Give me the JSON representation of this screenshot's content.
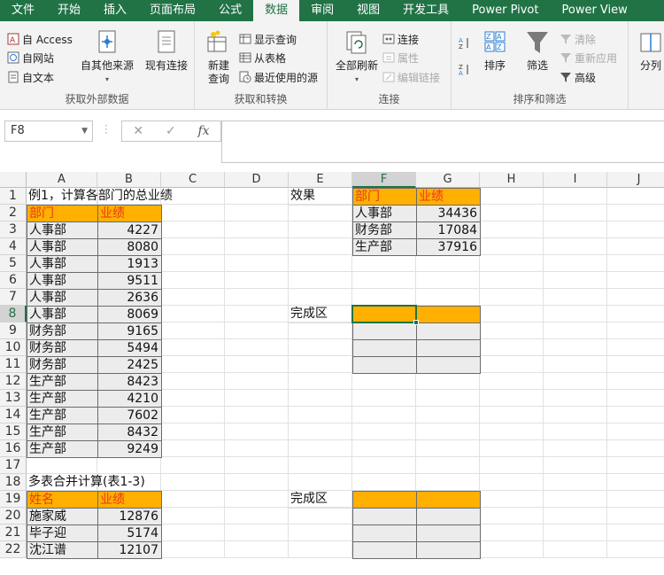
{
  "tabs": [
    "文件",
    "开始",
    "插入",
    "页面布局",
    "公式",
    "数据",
    "审阅",
    "视图",
    "开发工具",
    "Power Pivot",
    "Power View"
  ],
  "active_tab_index": 5,
  "ribbon": {
    "get_external": {
      "access": "自 Access",
      "web": "自网站",
      "text": "自文本",
      "other_sources": "自其他来源",
      "existing": "现有连接",
      "label": "获取外部数据"
    },
    "get_transform": {
      "new_query_line1": "新建",
      "new_query_line2": "查询",
      "show_queries": "显示查询",
      "from_table": "从表格",
      "recent_sources": "最近使用的源",
      "label": "获取和转换"
    },
    "connections": {
      "refresh_all": "全部刷新",
      "connections": "连接",
      "properties": "属性",
      "edit_links": "编辑链接",
      "label": "连接"
    },
    "sort_filter": {
      "sort": "排序",
      "filter": "筛选",
      "clear": "清除",
      "reapply": "重新应用",
      "advanced": "高级",
      "label": "排序和筛选"
    },
    "split": "分列"
  },
  "formula_bar": {
    "name_box": "F8",
    "fx": "fx",
    "cancel": "✕",
    "confirm": "✓"
  },
  "columns": [
    "A",
    "B",
    "C",
    "D",
    "E",
    "F",
    "G",
    "H",
    "I",
    "J"
  ],
  "selected_column": "F",
  "selected_row": 8,
  "rows": [
    "1",
    "2",
    "3",
    "4",
    "5",
    "6",
    "7",
    "8",
    "9",
    "10",
    "11",
    "12",
    "13",
    "14",
    "15",
    "16",
    "17",
    "18",
    "19",
    "20",
    "21",
    "22"
  ],
  "sheet": {
    "a1": "例1，计算各部门的总业绩",
    "table1_header": [
      "部门",
      "业绩"
    ],
    "table1_rows": [
      [
        "人事部",
        "4227"
      ],
      [
        "人事部",
        "8080"
      ],
      [
        "人事部",
        "1913"
      ],
      [
        "人事部",
        "9511"
      ],
      [
        "人事部",
        "2636"
      ],
      [
        "人事部",
        "8069"
      ],
      [
        "财务部",
        "9165"
      ],
      [
        "财务部",
        "5494"
      ],
      [
        "财务部",
        "2425"
      ],
      [
        "生产部",
        "8423"
      ],
      [
        "生产部",
        "4210"
      ],
      [
        "生产部",
        "7602"
      ],
      [
        "生产部",
        "8432"
      ],
      [
        "生产部",
        "9249"
      ]
    ],
    "e1": "效果",
    "result_header": [
      "部门",
      "业绩"
    ],
    "result_rows": [
      [
        "人事部",
        "34436"
      ],
      [
        "财务部",
        "17084"
      ],
      [
        "生产部",
        "37916"
      ]
    ],
    "e8": "完成区",
    "a18": "多表合并计算(表1-3)",
    "table2_header": [
      "姓名",
      "业绩"
    ],
    "table2_rows": [
      [
        "施家威",
        "12876"
      ],
      [
        "毕子迎",
        "5174"
      ],
      [
        "沈江谱",
        "12107"
      ]
    ],
    "e19": "完成区"
  },
  "colors": {
    "excel_green": "#217346",
    "header_fill": "#ffb000",
    "header_text": "#e8381c"
  }
}
